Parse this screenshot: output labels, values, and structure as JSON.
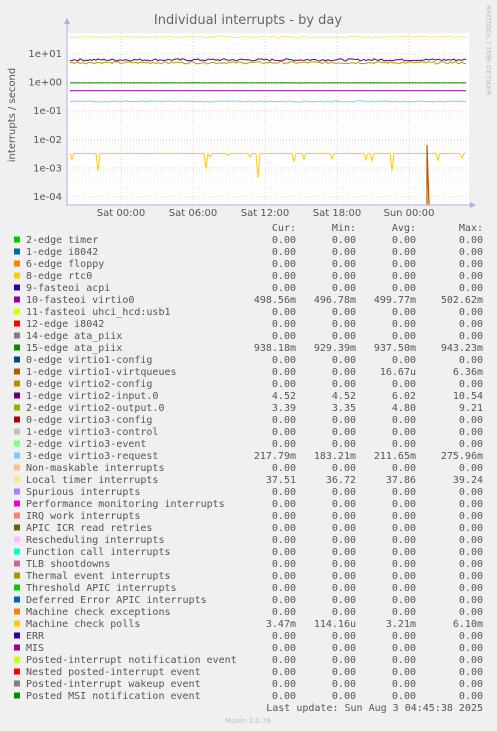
{
  "chart_data": {
    "type": "line",
    "title": "Individual interrupts - by day",
    "ylabel": "interrupts / second",
    "yscale": "log",
    "ylim": [
      5e-05,
      50
    ],
    "y_ticks": [
      "1e+01",
      "1e+00",
      "1e-01",
      "1e-02",
      "1e-03",
      "1e-04"
    ],
    "x_ticks": [
      "Sat 00:00",
      "Sat 06:00",
      "Sat 12:00",
      "Sat 18:00",
      "Sun 00:00"
    ],
    "grid": true,
    "side_text": "RRDTOOL / TOBI OETIKER",
    "columns": [
      "Cur:",
      "Min:",
      "Avg:",
      "Max:"
    ],
    "last_update": "Last update: Sun Aug  3 04:45:38 2025",
    "footer": "Munin 2.0.76",
    "series": [
      {
        "name": "2-edge      timer",
        "color": "#00cc00",
        "cur": "0.00",
        "min": "0.00",
        "avg": "0.00",
        "max": "0.00"
      },
      {
        "name": "1-edge      i8042",
        "color": "#0066b3",
        "cur": "0.00",
        "min": "0.00",
        "avg": "0.00",
        "max": "0.00"
      },
      {
        "name": "6-edge      floppy",
        "color": "#ff8000",
        "cur": "0.00",
        "min": "0.00",
        "avg": "0.00",
        "max": "0.00"
      },
      {
        "name": "8-edge      rtc0",
        "color": "#ffcc00",
        "cur": "0.00",
        "min": "0.00",
        "avg": "0.00",
        "max": "0.00"
      },
      {
        "name": "9-fasteoi   acpi",
        "color": "#330099",
        "cur": "0.00",
        "min": "0.00",
        "avg": "0.00",
        "max": "0.00"
      },
      {
        "name": "10-fasteoi   virtio0",
        "color": "#990099",
        "cur": "498.56m",
        "min": "496.78m",
        "avg": "499.77m",
        "max": "502.62m"
      },
      {
        "name": "11-fasteoi   uhci_hcd:usb1",
        "color": "#ccff00",
        "cur": "0.00",
        "min": "0.00",
        "avg": "0.00",
        "max": "0.00"
      },
      {
        "name": "12-edge      i8042",
        "color": "#ff0000",
        "cur": "0.00",
        "min": "0.00",
        "avg": "0.00",
        "max": "0.00"
      },
      {
        "name": "14-edge      ata_piix",
        "color": "#808080",
        "cur": "0.00",
        "min": "0.00",
        "avg": "0.00",
        "max": "0.00"
      },
      {
        "name": "15-edge      ata_piix",
        "color": "#008f00",
        "cur": "938.18m",
        "min": "929.39m",
        "avg": "937.50m",
        "max": "943.23m"
      },
      {
        "name": "0-edge      virtio1-config",
        "color": "#00487d",
        "cur": "0.00",
        "min": "0.00",
        "avg": "0.00",
        "max": "0.00"
      },
      {
        "name": "1-edge      virtio1-virtqueues",
        "color": "#b35a00",
        "cur": "0.00",
        "min": "0.00",
        "avg": "16.67u",
        "max": "6.36m"
      },
      {
        "name": "0-edge      virtio2-config",
        "color": "#b38f00",
        "cur": "0.00",
        "min": "0.00",
        "avg": "0.00",
        "max": "0.00"
      },
      {
        "name": "1-edge      virtio2-input.0",
        "color": "#6b006b",
        "cur": "4.52",
        "min": "4.52",
        "avg": "6.02",
        "max": "10.54"
      },
      {
        "name": "2-edge      virtio2-output.0",
        "color": "#8fb300",
        "cur": "3.39",
        "min": "3.35",
        "avg": "4.80",
        "max": "9.21"
      },
      {
        "name": "0-edge      virtio3-config",
        "color": "#b30000",
        "cur": "0.00",
        "min": "0.00",
        "avg": "0.00",
        "max": "0.00"
      },
      {
        "name": "1-edge      virtio3-control",
        "color": "#bebebe",
        "cur": "0.00",
        "min": "0.00",
        "avg": "0.00",
        "max": "0.00"
      },
      {
        "name": "2-edge      virtio3-event",
        "color": "#80ff80",
        "cur": "0.00",
        "min": "0.00",
        "avg": "0.00",
        "max": "0.00"
      },
      {
        "name": "3-edge      virtio3-request",
        "color": "#80c9ff",
        "cur": "217.79m",
        "min": "183.21m",
        "avg": "211.65m",
        "max": "275.96m"
      },
      {
        "name": "Non-maskable interrupts",
        "color": "#ffc080",
        "cur": "0.00",
        "min": "0.00",
        "avg": "0.00",
        "max": "0.00"
      },
      {
        "name": "Local timer interrupts",
        "color": "#ffe680",
        "cur": "37.51",
        "min": "36.72",
        "avg": "37.86",
        "max": "39.24"
      },
      {
        "name": "Spurious interrupts",
        "color": "#aa80ff",
        "cur": "0.00",
        "min": "0.00",
        "avg": "0.00",
        "max": "0.00"
      },
      {
        "name": "Performance monitoring interrupts",
        "color": "#ee00cc",
        "cur": "0.00",
        "min": "0.00",
        "avg": "0.00",
        "max": "0.00"
      },
      {
        "name": "IRQ work interrupts",
        "color": "#ff8080",
        "cur": "0.00",
        "min": "0.00",
        "avg": "0.00",
        "max": "0.00"
      },
      {
        "name": "APIC ICR read retries",
        "color": "#666600",
        "cur": "0.00",
        "min": "0.00",
        "avg": "0.00",
        "max": "0.00"
      },
      {
        "name": "Rescheduling interrupts",
        "color": "#ffbfff",
        "cur": "0.00",
        "min": "0.00",
        "avg": "0.00",
        "max": "0.00"
      },
      {
        "name": "Function call interrupts",
        "color": "#00ffcc",
        "cur": "0.00",
        "min": "0.00",
        "avg": "0.00",
        "max": "0.00"
      },
      {
        "name": "TLB shootdowns",
        "color": "#cc6699",
        "cur": "0.00",
        "min": "0.00",
        "avg": "0.00",
        "max": "0.00"
      },
      {
        "name": "Thermal event interrupts",
        "color": "#999900",
        "cur": "0.00",
        "min": "0.00",
        "avg": "0.00",
        "max": "0.00"
      },
      {
        "name": "Threshold APIC interrupts",
        "color": "#00cc00",
        "cur": "0.00",
        "min": "0.00",
        "avg": "0.00",
        "max": "0.00"
      },
      {
        "name": "Deferred Error APIC interrupts",
        "color": "#0066b3",
        "cur": "0.00",
        "min": "0.00",
        "avg": "0.00",
        "max": "0.00"
      },
      {
        "name": "Machine check exceptions",
        "color": "#ff8000",
        "cur": "0.00",
        "min": "0.00",
        "avg": "0.00",
        "max": "0.00"
      },
      {
        "name": "Machine check polls",
        "color": "#ffcc00",
        "cur": "3.47m",
        "min": "114.16u",
        "avg": "3.21m",
        "max": "6.10m"
      },
      {
        "name": "ERR",
        "color": "#330099",
        "cur": "0.00",
        "min": "0.00",
        "avg": "0.00",
        "max": "0.00"
      },
      {
        "name": "MIS",
        "color": "#990099",
        "cur": "0.00",
        "min": "0.00",
        "avg": "0.00",
        "max": "0.00"
      },
      {
        "name": "Posted-interrupt notification event",
        "color": "#ccff00",
        "cur": "0.00",
        "min": "0.00",
        "avg": "0.00",
        "max": "0.00"
      },
      {
        "name": "Nested posted-interrupt event",
        "color": "#ff0000",
        "cur": "0.00",
        "min": "0.00",
        "avg": "0.00",
        "max": "0.00"
      },
      {
        "name": "Posted-interrupt wakeup event",
        "color": "#808080",
        "cur": "0.00",
        "min": "0.00",
        "avg": "0.00",
        "max": "0.00"
      },
      {
        "name": "Posted MSI notification event",
        "color": "#008f00",
        "cur": "0.00",
        "min": "0.00",
        "avg": "0.00",
        "max": "0.00"
      }
    ],
    "plotted_lines": [
      {
        "name": "Local timer interrupts",
        "color": "#ffe680",
        "level": 37.86
      },
      {
        "name": "1-edge      virtio2-input.0",
        "color": "#6b006b",
        "level": 6.02
      },
      {
        "name": "2-edge      virtio2-output.0",
        "color": "#8fb300",
        "level": 4.8
      },
      {
        "name": "15-edge      ata_piix",
        "color": "#008f00",
        "level": 0.9375
      },
      {
        "name": "10-fasteoi   virtio0",
        "color": "#990099",
        "level": 0.4998
      },
      {
        "name": "3-edge      virtio3-request",
        "color": "#80c9ff",
        "level": 0.2117
      },
      {
        "name": "Machine check polls",
        "color": "#ffcc00",
        "level": 0.00321
      },
      {
        "name": "1-edge      virtio1-virtqueues",
        "color": "#b35a00",
        "level": 0.00636
      }
    ]
  }
}
